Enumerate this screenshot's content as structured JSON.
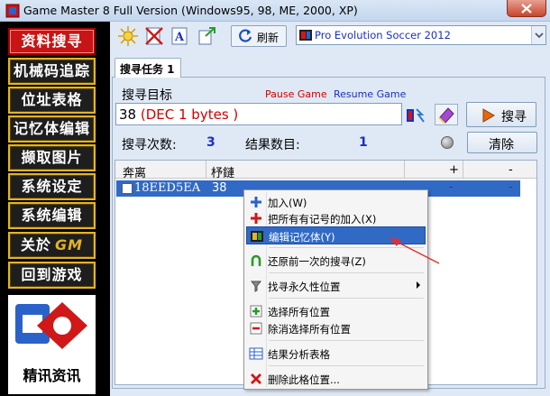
{
  "window": {
    "title": "Game Master 8 Full Version (Windows95, 98, ME, 2000, XP)",
    "close_icon": "close-icon"
  },
  "leftnav": {
    "items": [
      {
        "label": "资料搜寻",
        "active": true
      },
      {
        "label": "机械码追踪",
        "active": false
      },
      {
        "label": "位址表格",
        "active": false
      },
      {
        "label": "记忆体编辑",
        "active": false
      },
      {
        "label": "撷取图片",
        "active": false
      },
      {
        "label": "系统设定",
        "active": false
      },
      {
        "label": "系统编辑",
        "active": false
      },
      {
        "label": "关於",
        "active": false
      },
      {
        "label": "回到游戏",
        "active": false
      }
    ],
    "about_logo_text": "GM",
    "company_label": "精讯资讯"
  },
  "toolbar": {
    "refresh_label": "刷新",
    "process_name": "Pro Evolution Soccer 2012"
  },
  "tab": {
    "label": "搜寻任务 1"
  },
  "search": {
    "target_label": "搜寻目标",
    "pause_label": "Pause Game",
    "resume_label": "Resume Game",
    "value": "38",
    "value_unit": "(DEC 1 bytes )",
    "search_button": "搜寻",
    "count_label": "搜寻次数:",
    "count_value": "3",
    "result_label": "结果数目:",
    "result_value": "1",
    "clear_button": "清除"
  },
  "grid": {
    "columns": [
      "奔离",
      "杼鏈",
      "+",
      "-"
    ],
    "rows": [
      {
        "address": "18EED5EA",
        "value": "38",
        "plus": "-",
        "minus": "-"
      }
    ]
  },
  "context_menu": {
    "items": [
      {
        "label": "加入(W)",
        "icon": "plus-icon"
      },
      {
        "label": "把所有有记号的加入(X)",
        "icon": "plus-all-icon"
      },
      {
        "label": "编辑记忆体(Y)",
        "icon": "memory-edit-icon",
        "highlighted": true
      },
      {
        "label": "还原前一次的搜寻(Z)",
        "icon": "undo-icon"
      },
      {
        "label": "找寻永久性位置",
        "icon": "pointer-search-icon",
        "submenu": true
      },
      {
        "label": "选择所有位置",
        "icon": "select-all-icon"
      },
      {
        "label": "除消选择所有位置",
        "icon": "deselect-all-icon"
      },
      {
        "label": "结果分析表格",
        "icon": "table-icon"
      },
      {
        "label": "删除此格位置...",
        "icon": "delete-icon"
      }
    ]
  },
  "colors": {
    "accent_blue": "#1c2fbf",
    "selection": "#316ac5",
    "nav_active": "#c81414",
    "nav_border": "#e2b429",
    "annotation_arrow": "#e03030"
  }
}
